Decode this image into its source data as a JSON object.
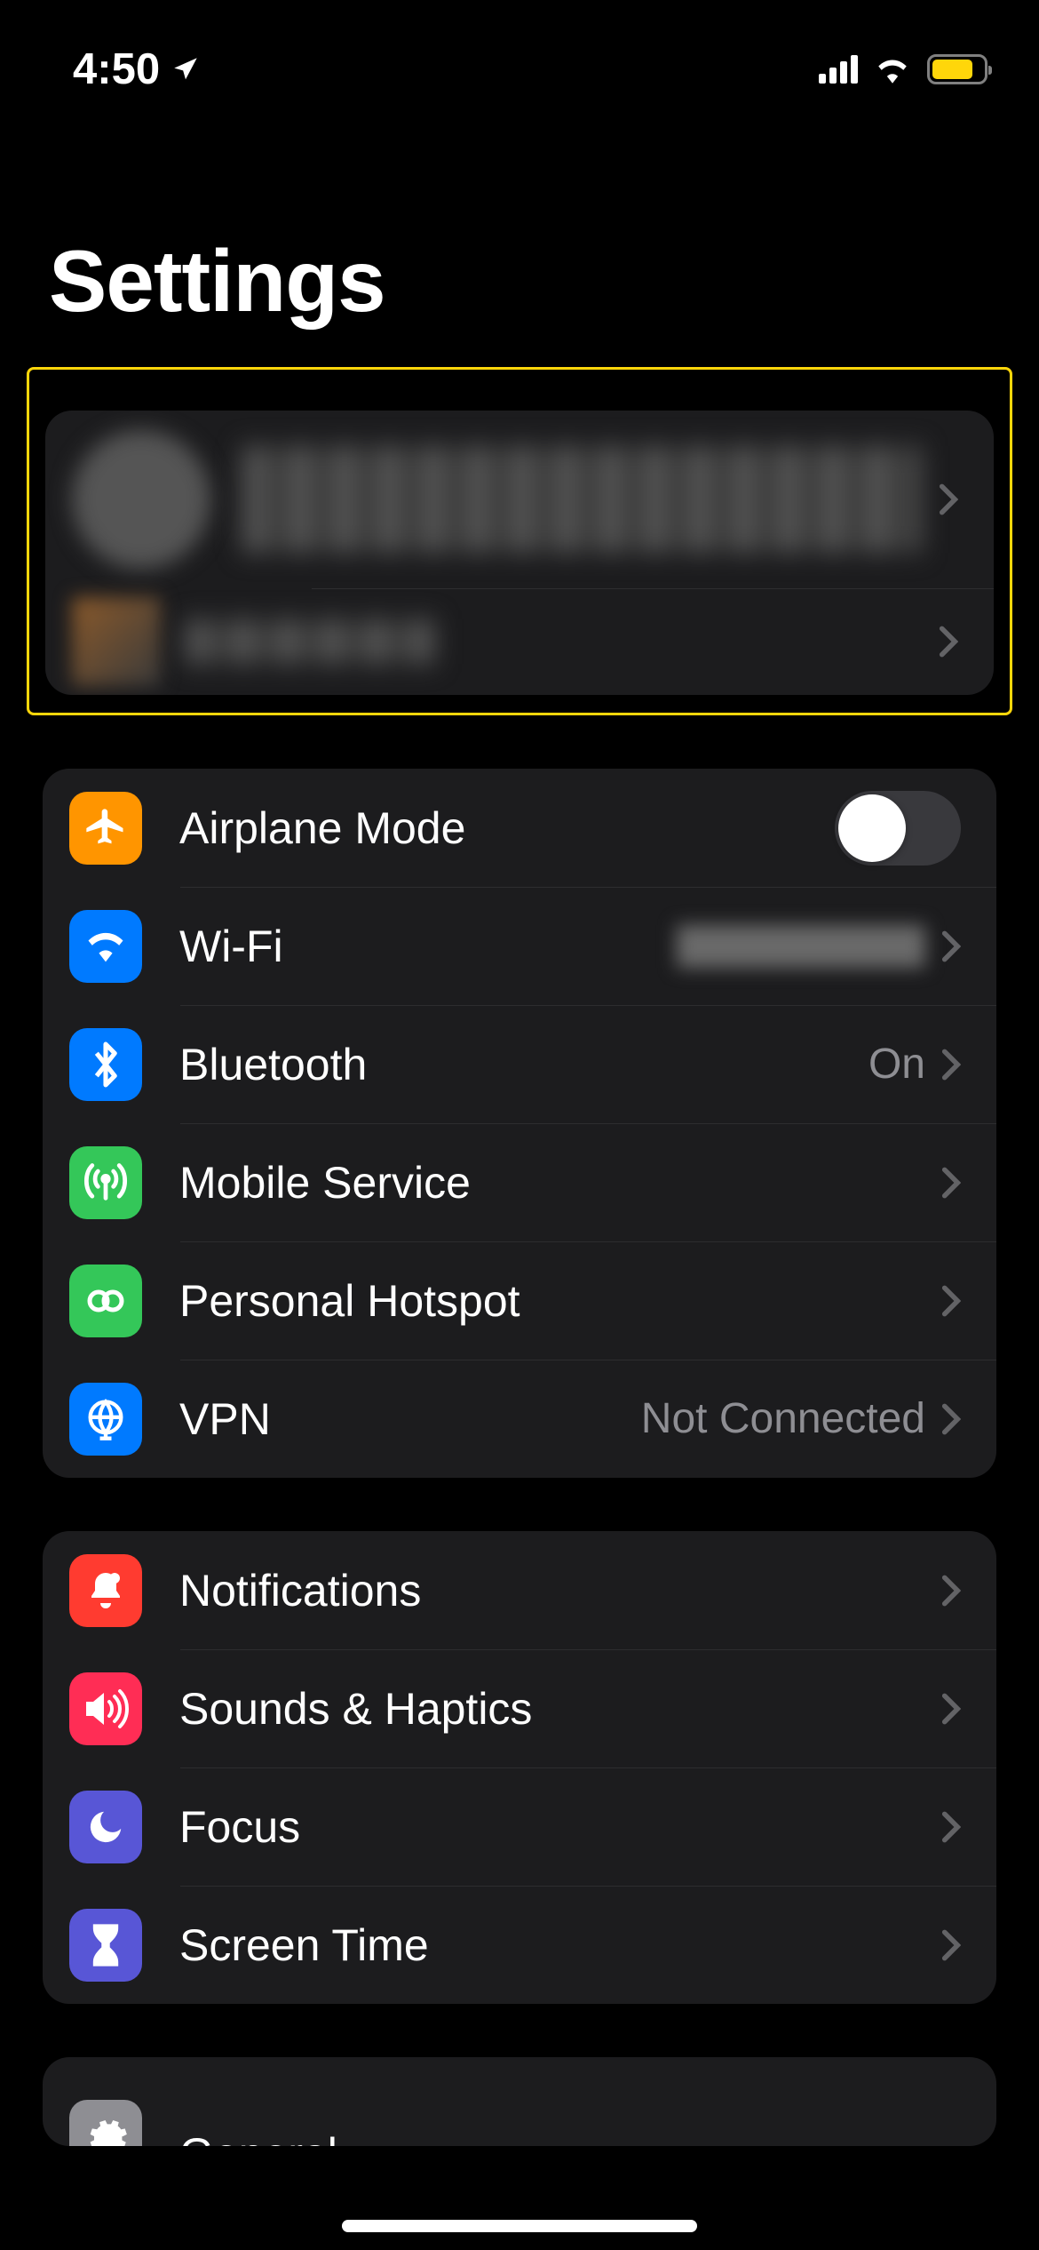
{
  "statusBar": {
    "time": "4:50"
  },
  "page": {
    "title": "Settings"
  },
  "profile": {
    "name": "",
    "subtitle": ""
  },
  "group1": {
    "airplane": {
      "label": "Airplane Mode",
      "on": false
    },
    "wifi": {
      "label": "Wi-Fi",
      "value": ""
    },
    "bluetooth": {
      "label": "Bluetooth",
      "value": "On"
    },
    "cellular": {
      "label": "Mobile Service"
    },
    "hotspot": {
      "label": "Personal Hotspot"
    },
    "vpn": {
      "label": "VPN",
      "value": "Not Connected"
    }
  },
  "group2": {
    "notifications": {
      "label": "Notifications"
    },
    "sounds": {
      "label": "Sounds & Haptics"
    },
    "focus": {
      "label": "Focus"
    },
    "screentime": {
      "label": "Screen Time"
    }
  },
  "group3": {
    "general": {
      "label": "General"
    }
  },
  "colors": {
    "orange": "#ff9500",
    "blue": "#007aff",
    "green": "#34c759",
    "red": "#ff3b30",
    "pink": "#ff2d55",
    "indigo": "#5856d6",
    "gray": "#8e8e93"
  }
}
